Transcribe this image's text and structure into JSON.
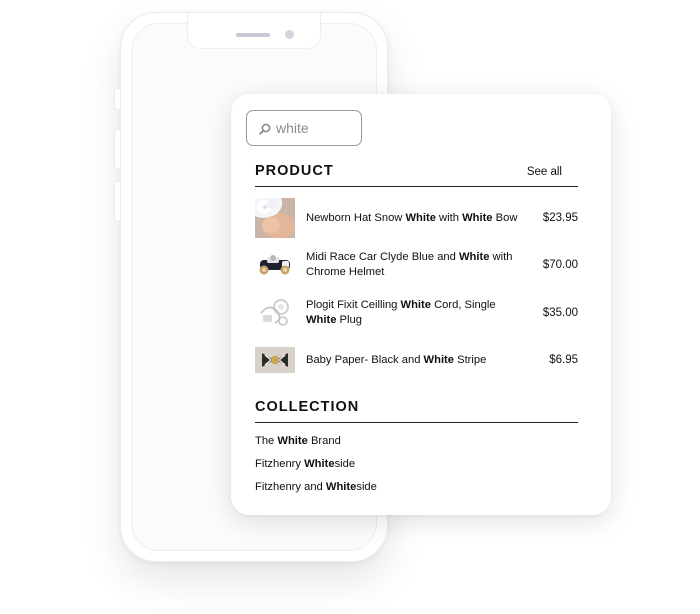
{
  "search": {
    "value": "white",
    "icon": "search-icon"
  },
  "product_section": {
    "title": "PRODUCT",
    "see_all_label": "See all",
    "items": [
      {
        "name_parts": [
          "Newborn Hat Snow ",
          "White",
          " with ",
          "White",
          " Bow"
        ],
        "price": "$23.95",
        "thumbnail": "baby-hat-photo"
      },
      {
        "name_parts": [
          "Midi Race Car Clyde Blue and ",
          "White",
          " with Chrome Helmet"
        ],
        "price": "$70.00",
        "thumbnail": "toy-race-car-photo"
      },
      {
        "name_parts": [
          "Plogit Fixit Ceilling ",
          "White",
          " Cord, Single ",
          "White",
          " Plug"
        ],
        "price": "$35.00",
        "thumbnail": "ceiling-cord-photo"
      },
      {
        "name_parts": [
          "Baby Paper- Black and ",
          "White",
          " Stripe"
        ],
        "price": "$6.95",
        "thumbnail": "striped-bow-photo"
      }
    ]
  },
  "collection_section": {
    "title": "COLLECTION",
    "items": [
      {
        "name_parts": [
          "The ",
          "White",
          " Brand"
        ]
      },
      {
        "name_parts": [
          "Fitzhenry ",
          "White",
          "side"
        ]
      },
      {
        "name_parts": [
          "Fitzhenry and ",
          "White",
          "side"
        ]
      }
    ]
  }
}
